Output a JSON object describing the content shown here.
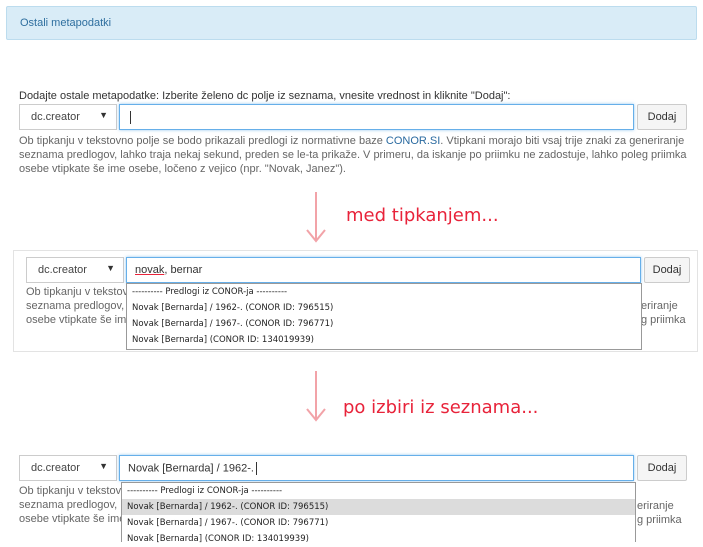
{
  "header": {
    "title": "Ostali metapodatki"
  },
  "instructions": "Dodajte ostale metapodatke: Izberite želeno dc polje iz seznama, vnesite vrednost in kliknite \"Dodaj\":",
  "field_select": {
    "value": "dc.creator"
  },
  "add_button": {
    "label": "Dodaj"
  },
  "help": {
    "line1_pre": "Ob tipkanju v tekstovno polje se bodo prikazali predlogi iz normativne baze ",
    "line1_link": "CONOR.SI",
    "line1_post": ". Vtipkani morajo biti vsaj trije znaki za generiranje",
    "line2": "seznama predlogov, lahko traja nekaj sekund, preden se le-ta prikaže. V primeru, da iskanje po priimku ne zadostuje, lahko poleg priimka",
    "line3": "osebe vtipkate še ime osebe, ločeno z vejico (npr. \"Novak, Janez\")."
  },
  "step1": {
    "input_value": ""
  },
  "caption1": "med tipkanjem...",
  "step2": {
    "input_word": "novak",
    "input_rest": ", bernar",
    "dropdown": {
      "header": "---------- Predlogi iz CONOR-ja ----------",
      "items": [
        "Novak [Bernarda] / 1962-. (CONOR ID: 796515)",
        "Novak [Bernarda] / 1967-. (CONOR ID: 796771)",
        "Novak [Bernarda] (CONOR ID: 134019939)"
      ]
    },
    "right_fragments": [
      "eriranje",
      "g priimka"
    ]
  },
  "caption2": "po izbiri iz seznama...",
  "step3": {
    "input_value": "Novak [Bernarda] / 1962-.",
    "selected_index": 0,
    "right_fragments": [
      "eriranje",
      "g priimka"
    ]
  },
  "colors": {
    "caption": "#e8233a",
    "arrow": "#f2a3a8",
    "header_bg": "#d9ecf7",
    "focus": "#66afe9"
  }
}
